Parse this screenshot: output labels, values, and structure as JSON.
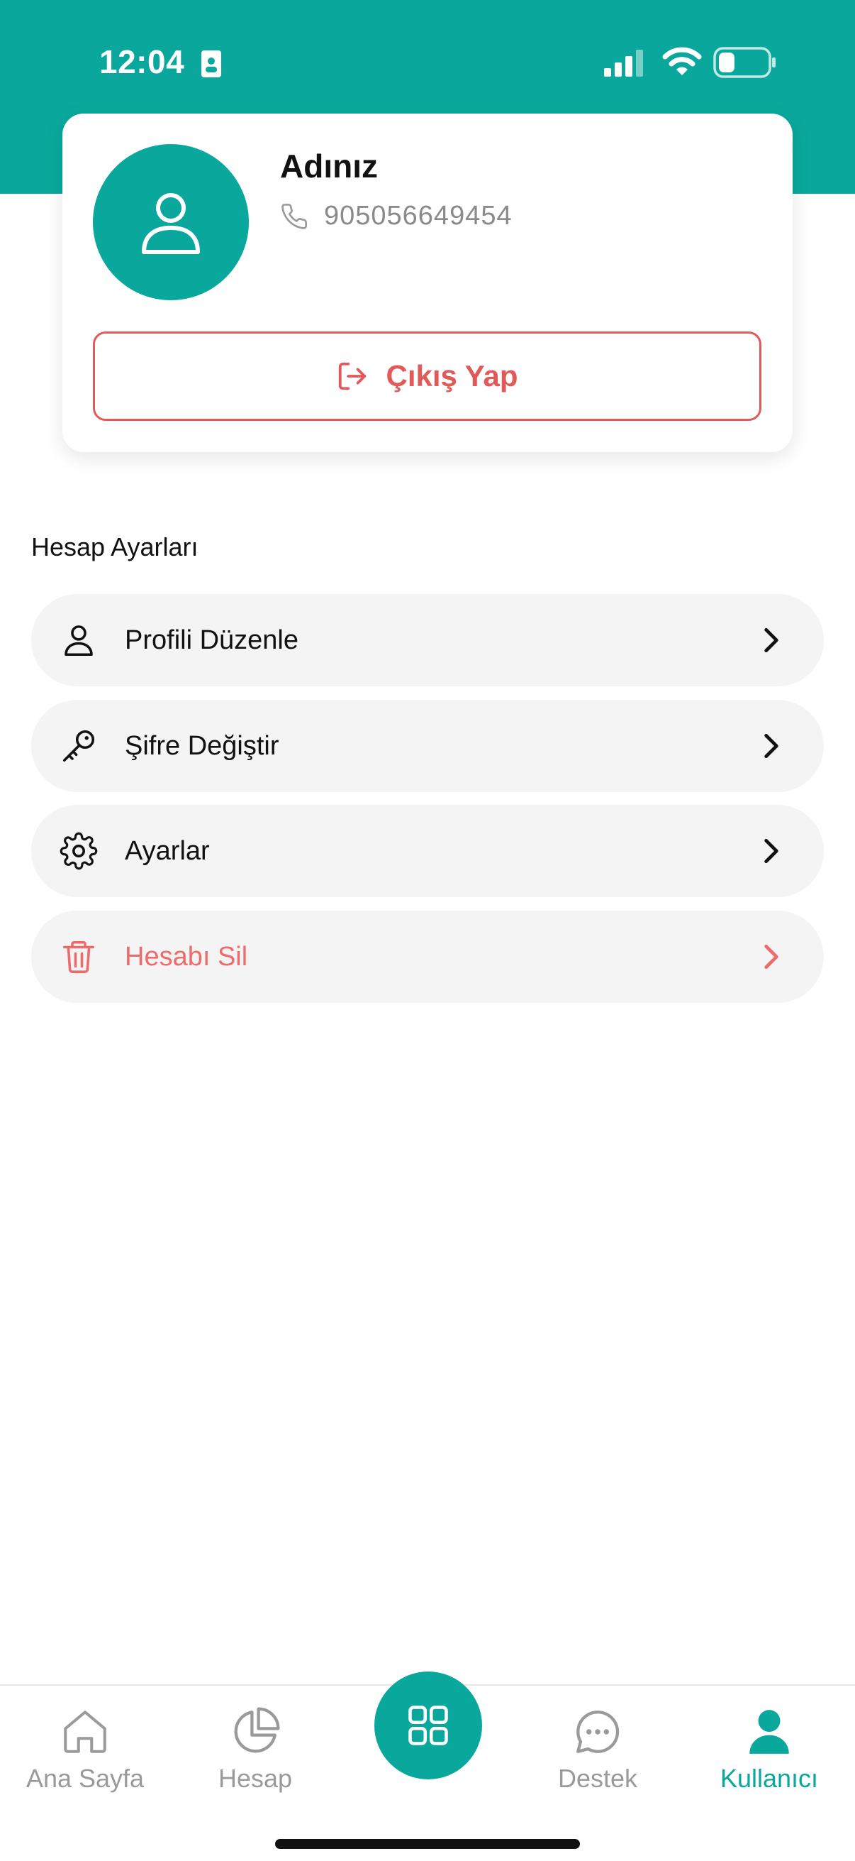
{
  "status_bar": {
    "time": "12:04"
  },
  "profile": {
    "name": "Adınız",
    "phone": "905056649454",
    "logout_label": "Çıkış Yap"
  },
  "account_settings": {
    "section_title": "Hesap Ayarları",
    "items": [
      {
        "label": "Profili Düzenle",
        "icon": "user-icon",
        "danger": false
      },
      {
        "label": "Şifre Değiştir",
        "icon": "key-icon",
        "danger": false
      },
      {
        "label": "Ayarlar",
        "icon": "gear-icon",
        "danger": false
      },
      {
        "label": "Hesabı Sil",
        "icon": "trash-icon",
        "danger": true
      }
    ]
  },
  "tab_bar": {
    "tabs": [
      {
        "label": "Ana Sayfa",
        "icon": "home-icon",
        "active": false
      },
      {
        "label": "Hesap",
        "icon": "pie-chart-icon",
        "active": false
      },
      {
        "label": "",
        "icon": "grid-icon",
        "active": false
      },
      {
        "label": "Destek",
        "icon": "chat-icon",
        "active": false
      },
      {
        "label": "Kullanıcı",
        "icon": "user-filled-icon",
        "active": true
      }
    ]
  },
  "colors": {
    "primary": "#0aa89c",
    "danger": "#e15a5a",
    "inactive_tab": "#9a9a9a",
    "menu_background": "#f4f4f4"
  }
}
